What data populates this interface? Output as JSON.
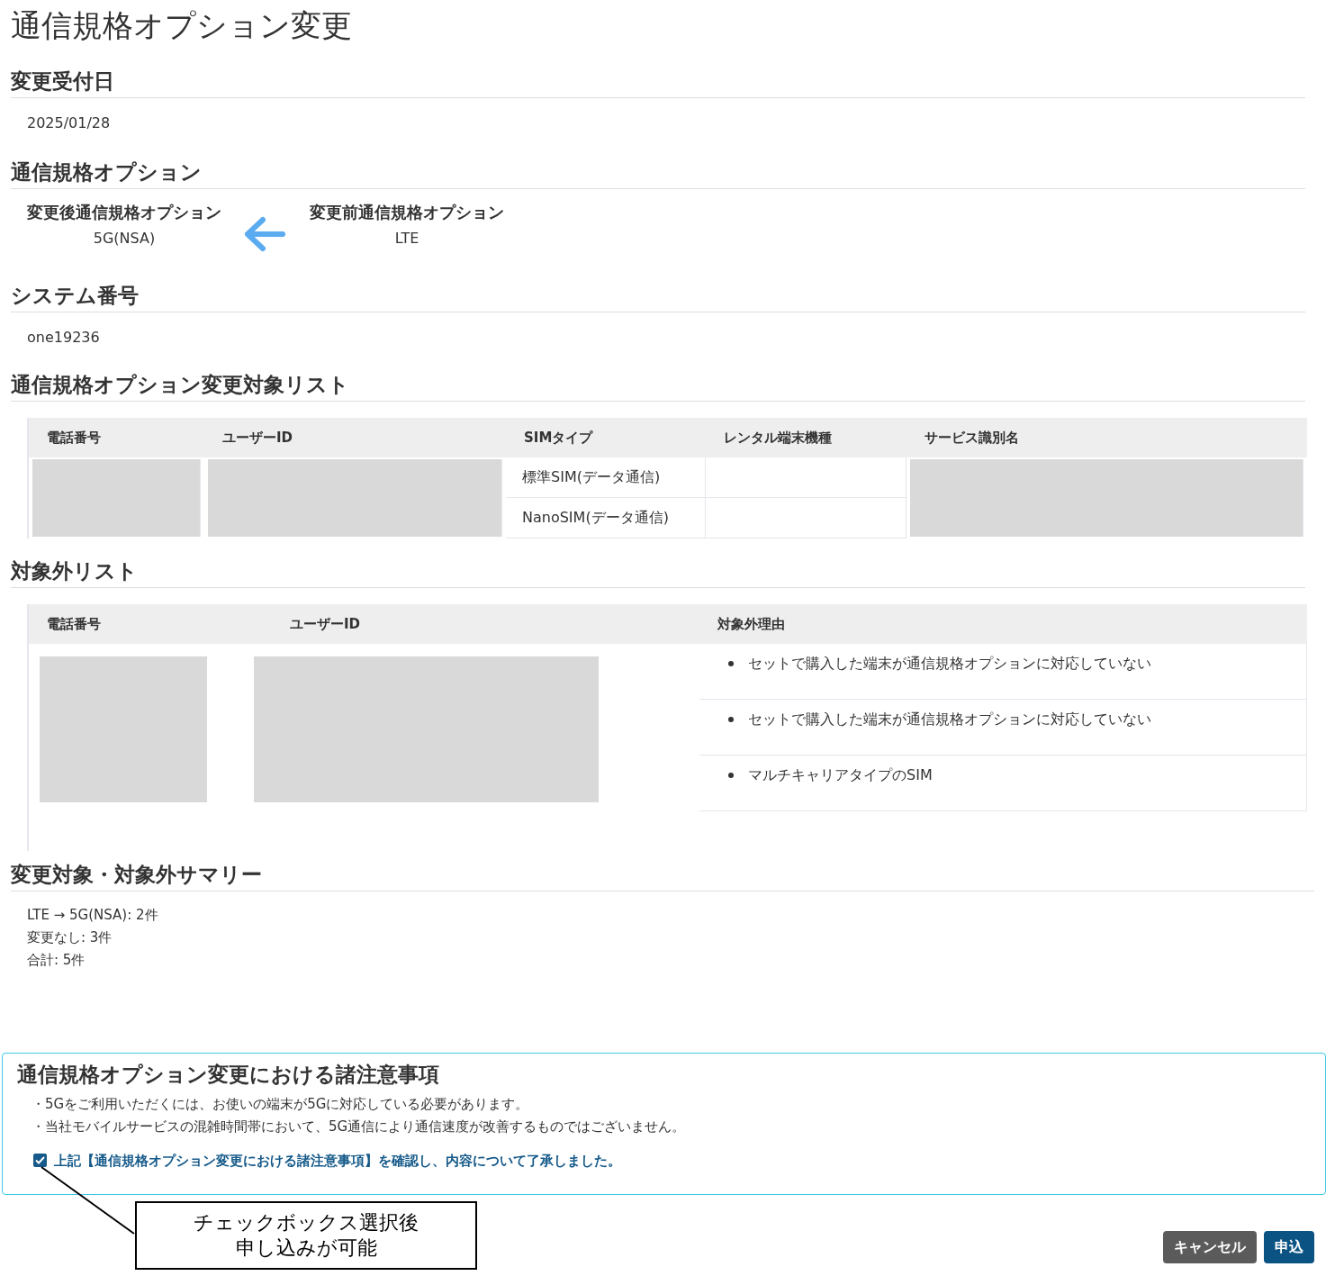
{
  "title": "通信規格オプション変更",
  "reception": {
    "heading": "変更受付日",
    "value": "2025/01/28"
  },
  "option": {
    "heading": "通信規格オプション",
    "after": {
      "label": "変更後通信規格オプション",
      "value": "5G(NSA)"
    },
    "before": {
      "label": "変更前通信規格オプション",
      "value": "LTE"
    }
  },
  "system": {
    "heading": "システム番号",
    "value": "one19236"
  },
  "target_list": {
    "heading": "通信規格オプション変更対象リスト",
    "columns": [
      {
        "label": "電話番号",
        "masked": true
      },
      {
        "label": "ユーザーID",
        "masked": true
      },
      {
        "label": "SIMタイプ",
        "masked": false
      },
      {
        "label": "レンタル端末機種",
        "masked": false
      },
      {
        "label": "サービス識別名",
        "masked": true
      }
    ],
    "rows": [
      {
        "sim_type": "標準SIM(データ通信)"
      },
      {
        "sim_type": "NanoSIM(データ通信)"
      }
    ]
  },
  "excluded_list": {
    "heading": "対象外リスト",
    "columns": [
      {
        "label": "電話番号",
        "masked": true
      },
      {
        "label": "ユーザーID",
        "masked": true
      },
      {
        "label": "対象外理由",
        "masked": false
      }
    ],
    "rows": [
      {
        "reason": "セットで購入した端末が通信規格オプションに対応していない"
      },
      {
        "reason": "セットで購入した端末が通信規格オプションに対応していない"
      },
      {
        "reason": "マルチキャリアタイプのSIM"
      }
    ]
  },
  "summary": {
    "heading": "変更対象・対象外サマリー",
    "lines": [
      "LTE → 5G(NSA): 2件",
      "変更なし: 3件",
      "合計: 5件"
    ]
  },
  "notice": {
    "heading": "通信規格オプション変更における諸注意事項",
    "items": [
      "・5Gをご利用いただくには、お使いの端末が5Gに対応している必要があります。",
      "・当社モバイルサービスの混雑時間帯において、5G通信により通信速度が改善するものではございません。"
    ],
    "agreement": {
      "label": "上記【通信規格オプション変更における諸注意事項】を確認し、内容について了承しました。",
      "checked": true
    }
  },
  "annotation": {
    "lines": [
      "チェックボックス選択後",
      "申し込みが可能"
    ]
  },
  "buttons": [
    {
      "label": "キャンセル",
      "kind": "secondary"
    },
    {
      "label": "申込",
      "kind": "primary"
    }
  ]
}
